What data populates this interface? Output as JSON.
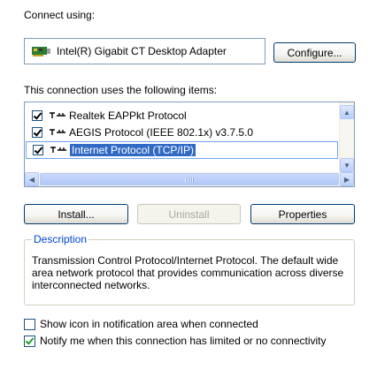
{
  "connect_using_label": "Connect using:",
  "adapter": {
    "name": "Intel(R) Gigabit CT Desktop Adapter",
    "icon": "network-adapter-icon"
  },
  "configure_button": "Configure...",
  "items_label": "This connection uses the following items:",
  "items": [
    {
      "label": "Realtek EAPPkt Protocol",
      "checked": true,
      "icon": "protocol-icon"
    },
    {
      "label": "AEGIS Protocol (IEEE 802.1x) v3.7.5.0",
      "checked": true,
      "icon": "protocol-icon"
    },
    {
      "label": "Internet Protocol (TCP/IP)",
      "checked": true,
      "icon": "protocol-icon",
      "selected": true
    }
  ],
  "buttons": {
    "install": "Install...",
    "uninstall": "Uninstall",
    "properties": "Properties"
  },
  "description": {
    "title": "Description",
    "text": "Transmission Control Protocol/Internet Protocol. The default wide area network protocol that provides communication across diverse interconnected networks."
  },
  "options": [
    {
      "label": "Show icon in notification area when connected",
      "checked": false
    },
    {
      "label": "Notify me when this connection has limited or no connectivity",
      "checked": true
    }
  ],
  "colors": {
    "accent": "#316ac5",
    "border": "#7f9db9",
    "group_title": "#0046d5"
  }
}
